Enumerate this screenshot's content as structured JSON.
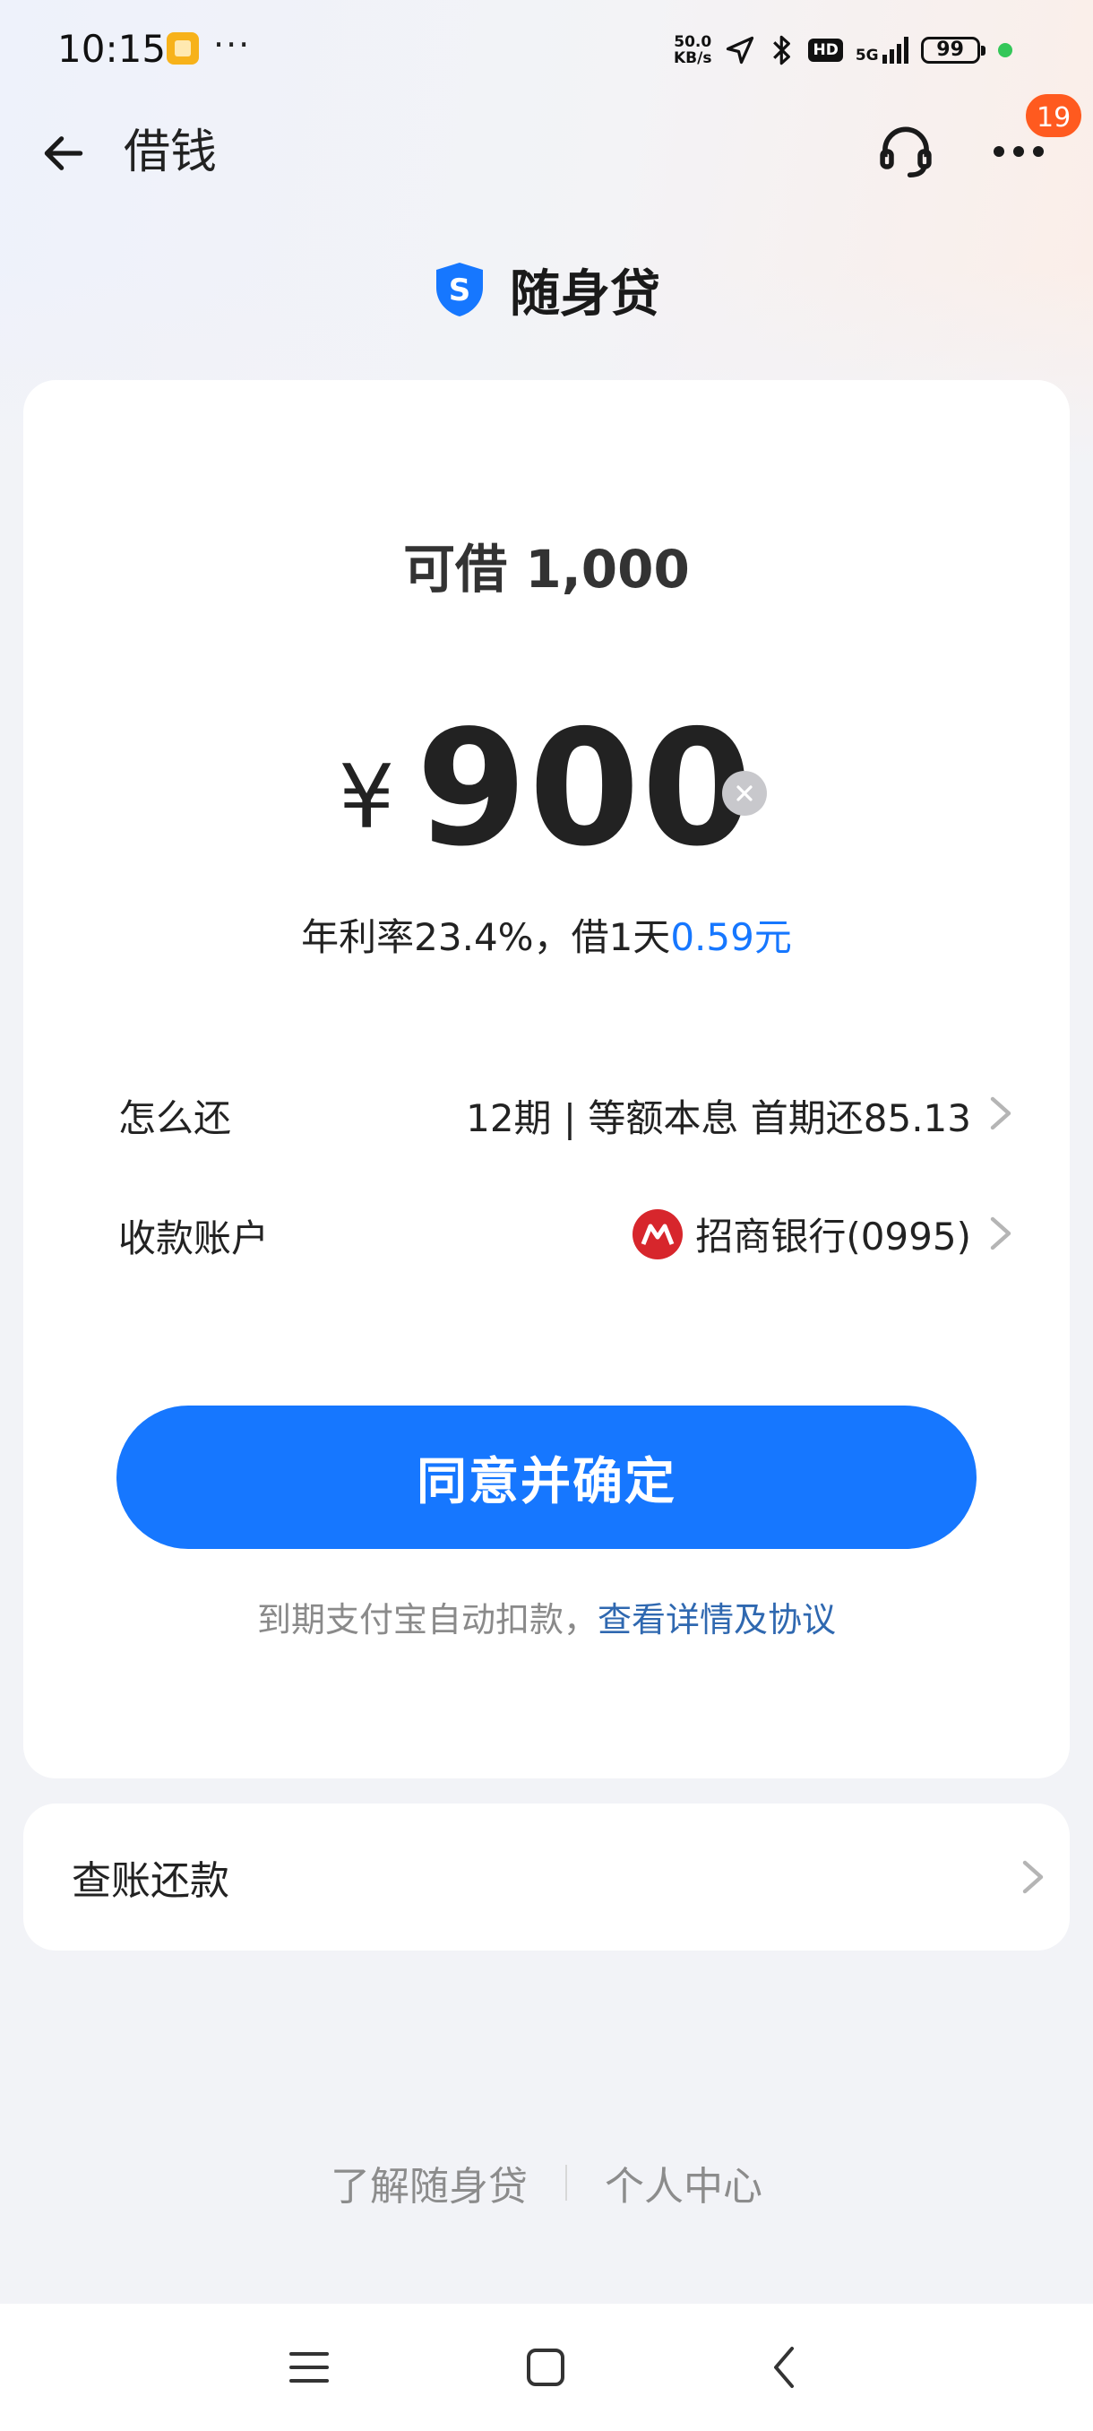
{
  "status_bar": {
    "time": "10:15",
    "dots": "···",
    "net_speed_value": "50.0",
    "net_speed_unit": "KB/s",
    "hd": "HD",
    "network": "5G",
    "battery": "99"
  },
  "header": {
    "title": "借钱",
    "notification_count": "19"
  },
  "product": {
    "name": "随身贷",
    "icon_letter": "S",
    "brand_color": "#1677ff"
  },
  "loan": {
    "available_label": "可借 1,000",
    "currency": "¥",
    "amount": "900",
    "rate_text": "年利率23.4%，借1天",
    "daily_cost": "0.59元"
  },
  "repayment": {
    "label": "怎么还",
    "value": "12期 | 等额本息 首期还85.13"
  },
  "account": {
    "label": "收款账户",
    "value": "招商银行(0995)"
  },
  "confirm": {
    "label": "同意并确定"
  },
  "agreement": {
    "text": "到期支付宝自动扣款，",
    "link": "查看详情及协议"
  },
  "bill": {
    "label": "查账还款"
  },
  "footer": {
    "learn": "了解随身贷",
    "personal": "个人中心"
  },
  "colors": {
    "accent": "#1677ff",
    "badge": "#ff5a1f",
    "bank_logo": "#d7262c"
  }
}
